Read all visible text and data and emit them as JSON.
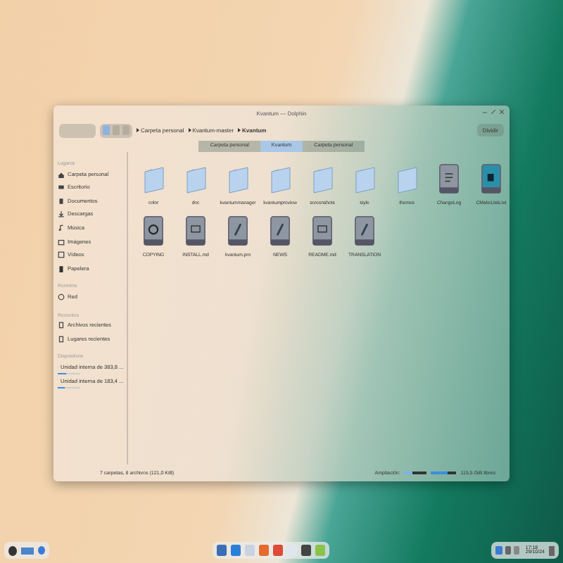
{
  "window": {
    "title": "Kvantum — Dolphin"
  },
  "toolbar": {
    "breadcrumb": [
      "Carpeta personal",
      "Kvantum-master",
      "Kvantum"
    ],
    "split_button": "Dividir"
  },
  "tabs": [
    {
      "label": "Carpeta personal",
      "selected": false
    },
    {
      "label": "Kvantum",
      "selected": true
    },
    {
      "label": "Carpeta personal",
      "selected": false
    }
  ],
  "sidebar": {
    "sections": [
      {
        "title": "Lugares",
        "items": [
          {
            "label": "Carpeta personal",
            "kind": "home"
          },
          {
            "label": "Escritorio",
            "kind": "desktop"
          },
          {
            "label": "Documentos",
            "kind": "docs"
          },
          {
            "label": "Descargas",
            "kind": "download"
          },
          {
            "label": "Música",
            "kind": "music"
          },
          {
            "label": "Imágenes",
            "kind": "image"
          },
          {
            "label": "Vídeos",
            "kind": "video"
          },
          {
            "label": "Papelera",
            "kind": "trash"
          }
        ]
      },
      {
        "title": "Remotos",
        "items": [
          {
            "label": "Red",
            "kind": "network"
          }
        ]
      },
      {
        "title": "Recientes",
        "items": [
          {
            "label": "Archivos recientes",
            "kind": "recent"
          },
          {
            "label": "Lugares recientes",
            "kind": "recent"
          }
        ]
      },
      {
        "title": "Dispositivos",
        "items": [
          {
            "label": "Unidad interna de 383,8 ...",
            "kind": "drive",
            "level": 0.35
          },
          {
            "label": "Unidad interna de 183,4 ...",
            "kind": "drive",
            "level": 0.3
          }
        ]
      }
    ]
  },
  "files": [
    {
      "name": "color",
      "kind": "folder"
    },
    {
      "name": "doc",
      "kind": "folder"
    },
    {
      "name": "kvantummanager",
      "kind": "folder"
    },
    {
      "name": "kvantumpreview",
      "kind": "folder"
    },
    {
      "name": "screenshots",
      "kind": "folder"
    },
    {
      "name": "style",
      "kind": "folder"
    },
    {
      "name": "themes",
      "kind": "folder"
    },
    {
      "name": "ChangeLog",
      "kind": "text"
    },
    {
      "name": "CMakeLists.txt",
      "kind": "cmake"
    },
    {
      "name": "COPYING",
      "kind": "license"
    },
    {
      "name": "INSTALL.md",
      "kind": "markdown"
    },
    {
      "name": "kvantum.pro",
      "kind": "attach"
    },
    {
      "name": "NEWS",
      "kind": "attach"
    },
    {
      "name": "README.md",
      "kind": "markdown"
    },
    {
      "name": "TRANSLATION",
      "kind": "attach"
    }
  ],
  "status_bar": {
    "summary": "7 carpetas, 8 archivos (121,0 KiB)",
    "zoom_label": "Ampliación:",
    "zoom": {
      "level": 0.35
    },
    "free_space": {
      "level": 0.65
    },
    "free_label": "115,5 GiB libres"
  },
  "taskbar": {
    "clock": {
      "time": "17:18",
      "date": "29/10/24"
    }
  }
}
